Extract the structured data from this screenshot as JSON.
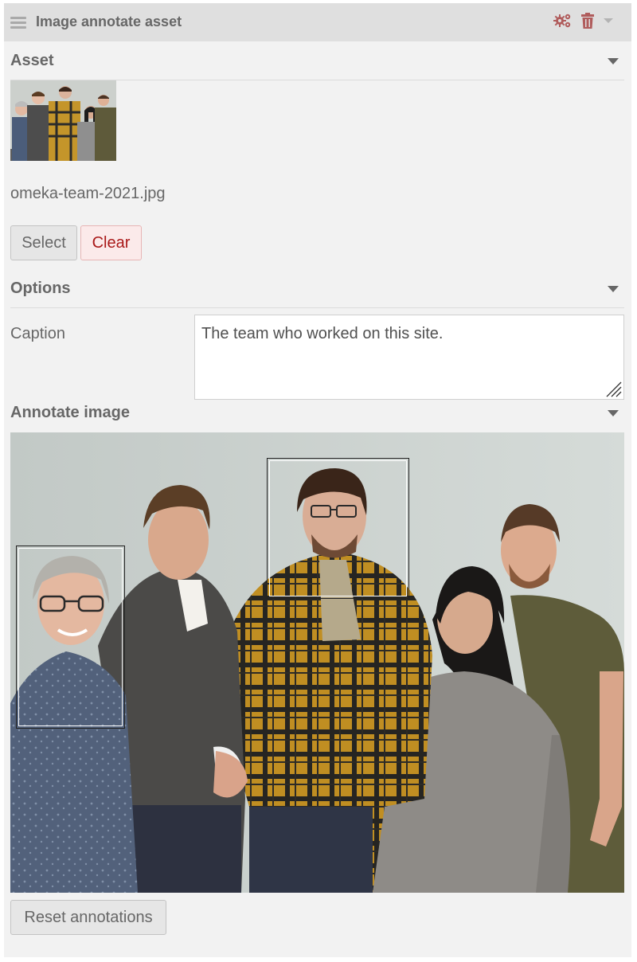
{
  "block": {
    "title": "Image annotate asset",
    "icons": [
      "hamburger-icon",
      "gears-icon",
      "trash-icon",
      "caret-down-icon"
    ],
    "accent_color": "#b05c5c"
  },
  "asset": {
    "section_title": "Asset",
    "filename": "omeka-team-2021.jpg",
    "select_label": "Select",
    "clear_label": "Clear"
  },
  "options": {
    "section_title": "Options",
    "caption_label": "Caption",
    "caption_value": "The team who worked on this site."
  },
  "annotate": {
    "section_title": "Annotate image",
    "annotation_count": 2,
    "reset_label": "Reset annotations"
  }
}
